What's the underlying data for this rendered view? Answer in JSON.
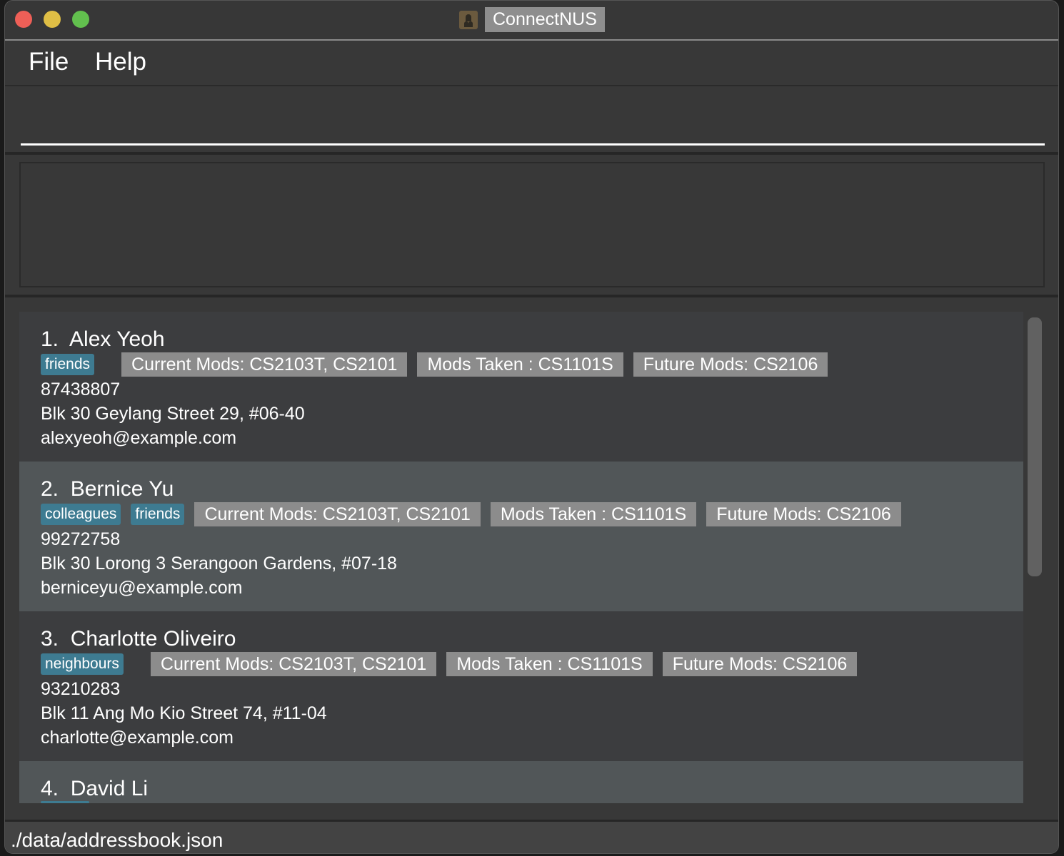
{
  "window": {
    "title": "ConnectNUS",
    "app_icon": "contact-book-icon"
  },
  "traffic_lights": {
    "close": "#ee5f57",
    "minimize": "#dfbe45",
    "zoom": "#62c04e"
  },
  "menu": {
    "file": "File",
    "help": "Help"
  },
  "command_box": {
    "value": ""
  },
  "result_display": {
    "text": ""
  },
  "persons": [
    {
      "index": "1.",
      "name": "Alex Yeoh",
      "tags": [
        "friends"
      ],
      "current_mods": "Current Mods: CS2103T, CS2101",
      "mods_taken": "Mods Taken : CS1101S",
      "future_mods": "Future Mods: CS2106",
      "phone": "87438807",
      "address": "Blk 30 Geylang Street 29, #06-40",
      "email": "alexyeoh@example.com"
    },
    {
      "index": "2.",
      "name": "Bernice Yu",
      "tags": [
        "colleagues",
        "friends"
      ],
      "current_mods": "Current Mods: CS2103T, CS2101",
      "mods_taken": "Mods Taken : CS1101S",
      "future_mods": "Future Mods: CS2106",
      "phone": "99272758",
      "address": "Blk 30 Lorong 3 Serangoon Gardens, #07-18",
      "email": "berniceyu@example.com"
    },
    {
      "index": "3.",
      "name": "Charlotte Oliveiro",
      "tags": [
        "neighbours"
      ],
      "current_mods": "Current Mods: CS2103T, CS2101",
      "mods_taken": "Mods Taken : CS1101S",
      "future_mods": "Future Mods: CS2106",
      "phone": "93210283",
      "address": "Blk 11 Ang Mo Kio Street 74, #11-04",
      "email": "charlotte@example.com"
    },
    {
      "index": "4.",
      "name": "David Li"
    }
  ],
  "colors": {
    "tag": "#3e7b91",
    "mod_tag": "#8c8c8c",
    "card_odd": "#3c3d3f",
    "card_even": "#515658"
  },
  "status_bar": {
    "path": "./data/addressbook.json"
  }
}
